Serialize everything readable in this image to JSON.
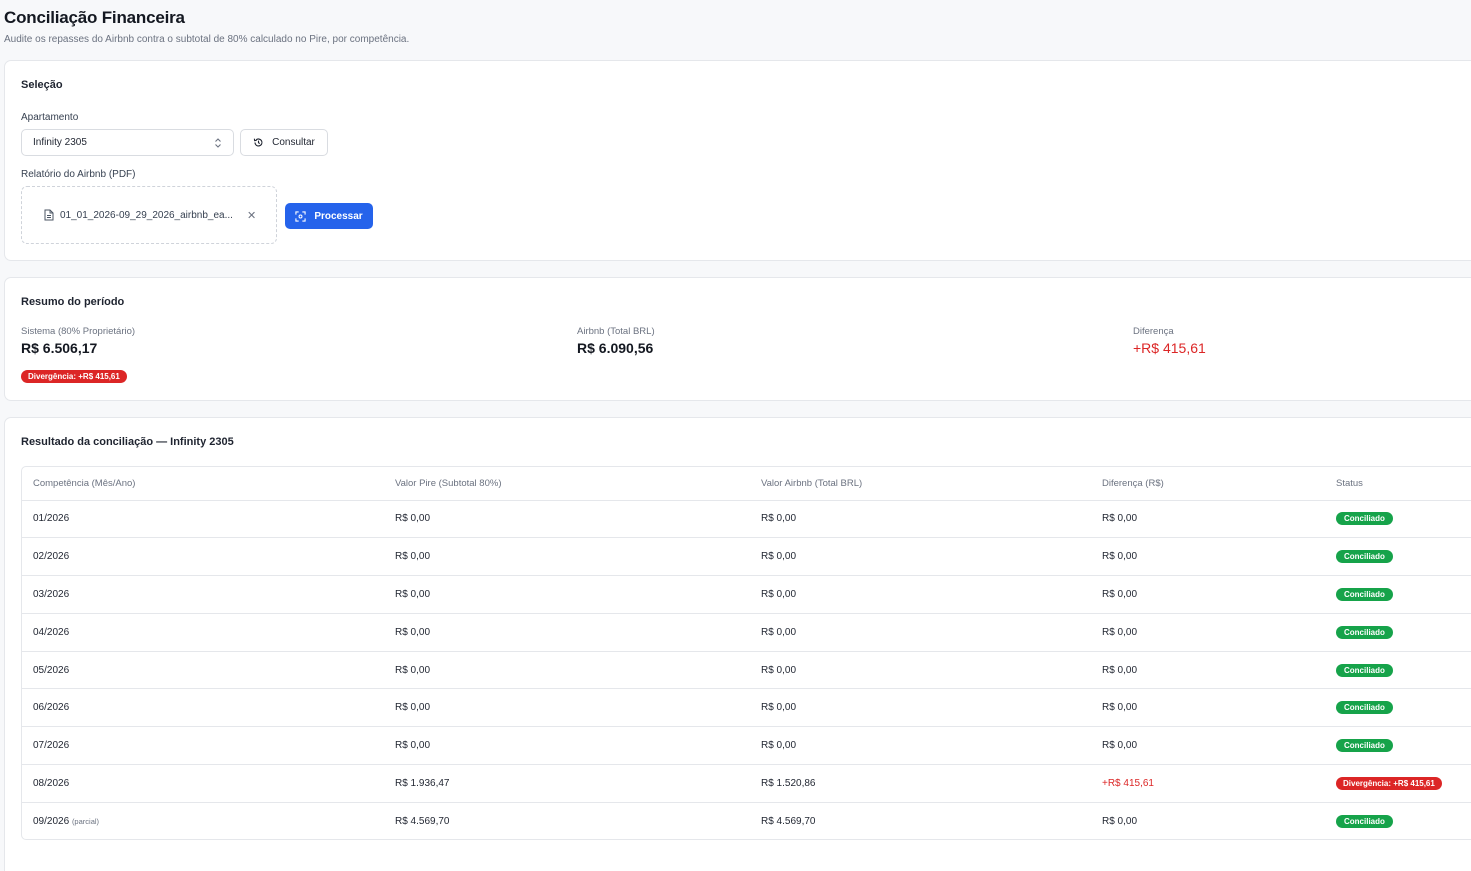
{
  "header": {
    "title": "Conciliação Financeira",
    "subtitle": "Audite os repasses do Airbnb contra o subtotal de 80% calculado no Pire, por competência."
  },
  "selection": {
    "title": "Seleção",
    "apartment_label": "Apartamento",
    "apartment_value": "Infinity 2305",
    "consult_label": "Consultar",
    "report_label": "Relatório do Airbnb (PDF)",
    "file_name": "01_01_2026-09_29_2026_airbnb_ea...",
    "process_label": "Processar"
  },
  "summary": {
    "title": "Resumo do período",
    "system_label": "Sistema (80% Proprietário)",
    "system_value": "R$ 6.506,17",
    "airbnb_label": "Airbnb (Total BRL)",
    "airbnb_value": "R$ 6.090,56",
    "diff_label": "Diferença",
    "diff_value": "+R$ 415,61",
    "badge": "Divergência: +R$ 415,61"
  },
  "result": {
    "title": "Resultado da conciliação — Infinity 2305",
    "columns": [
      "Competência (Mês/Ano)",
      "Valor Pire (Subtotal 80%)",
      "Valor Airbnb (Total BRL)",
      "Diferença (R$)",
      "Status"
    ],
    "rows": [
      {
        "month": "01/2026",
        "note": "",
        "pire": "R$ 0,00",
        "airbnb": "R$ 0,00",
        "diff": "R$ 0,00",
        "status": "Conciliado"
      },
      {
        "month": "02/2026",
        "note": "",
        "pire": "R$ 0,00",
        "airbnb": "R$ 0,00",
        "diff": "R$ 0,00",
        "status": "Conciliado"
      },
      {
        "month": "03/2026",
        "note": "",
        "pire": "R$ 0,00",
        "airbnb": "R$ 0,00",
        "diff": "R$ 0,00",
        "status": "Conciliado"
      },
      {
        "month": "04/2026",
        "note": "",
        "pire": "R$ 0,00",
        "airbnb": "R$ 0,00",
        "diff": "R$ 0,00",
        "status": "Conciliado"
      },
      {
        "month": "05/2026",
        "note": "",
        "pire": "R$ 0,00",
        "airbnb": "R$ 0,00",
        "diff": "R$ 0,00",
        "status": "Conciliado"
      },
      {
        "month": "06/2026",
        "note": "",
        "pire": "R$ 0,00",
        "airbnb": "R$ 0,00",
        "diff": "R$ 0,00",
        "status": "Conciliado"
      },
      {
        "month": "07/2026",
        "note": "",
        "pire": "R$ 0,00",
        "airbnb": "R$ 0,00",
        "diff": "R$ 0,00",
        "status": "Conciliado"
      },
      {
        "month": "08/2026",
        "note": "",
        "pire": "R$ 1.936,47",
        "airbnb": "R$ 1.520,86",
        "diff": "+R$ 415,61",
        "status": "Divergência: +R$ 415,61",
        "alert": true
      },
      {
        "month": "09/2026",
        "note": "(parcial)",
        "pire": "R$ 4.569,70",
        "airbnb": "R$ 4.569,70",
        "diff": "R$ 0,00",
        "status": "Conciliado"
      }
    ]
  },
  "colors": {
    "primary": "#2563eb",
    "success": "#16a34a",
    "danger": "#dc2626"
  }
}
